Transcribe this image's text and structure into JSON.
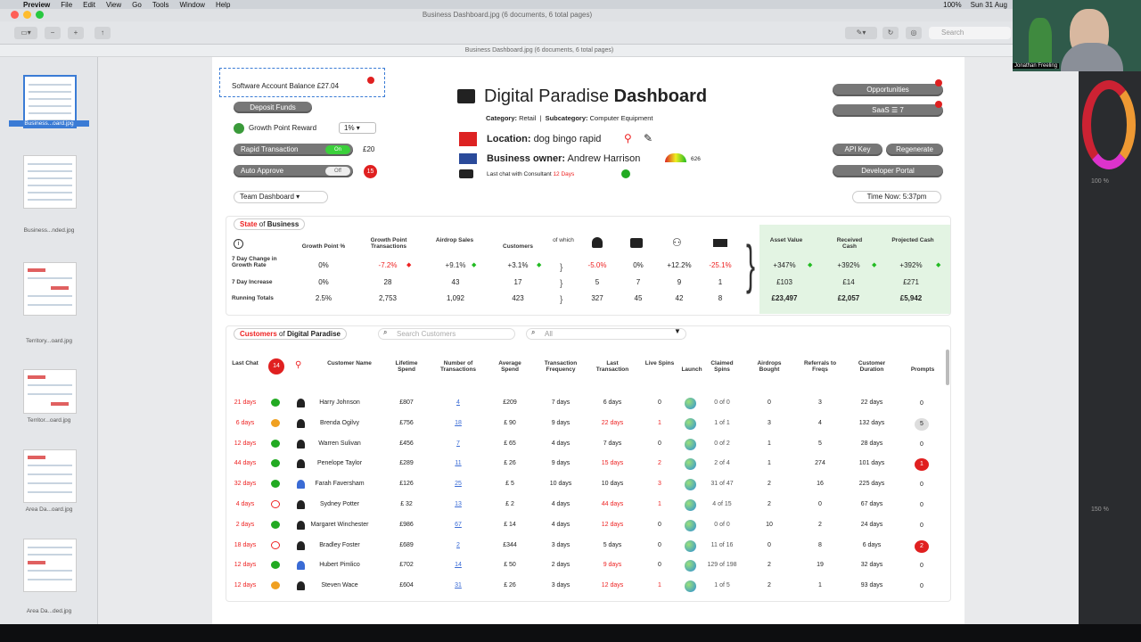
{
  "menubar": {
    "app": "Preview",
    "items": [
      "File",
      "Edit",
      "View",
      "Go",
      "Tools",
      "Window",
      "Help"
    ],
    "status": [
      "100%",
      "Sun 31 Aug"
    ]
  },
  "window": {
    "title": "Business Dashboard.jpg (6 documents, 6 total pages)",
    "subtitle": "Business Dashboard.jpg (6 documents, 6 total pages)",
    "search_placeholder": "Search"
  },
  "sidebar": {
    "thumbs": [
      {
        "label": "Business...oard.jpg"
      },
      {
        "label": "Business...nded.jpg"
      },
      {
        "label": "Territory...oard.jpg"
      },
      {
        "label": "Territor...oard.jpg"
      },
      {
        "label": "Area Da...oard.jpg"
      },
      {
        "label": "Area Da...ded.jpg"
      }
    ]
  },
  "video": {
    "name": "Jonathan Freeling"
  },
  "right_panel": {
    "zoom1": "100 %",
    "zoom2": "150 %"
  },
  "dash": {
    "account_balance": "Software Account Balance £27.04",
    "deposit": "Deposit Funds",
    "growth_reward": "Growth Point Reward",
    "growth_pct": "1%",
    "rapid": "Rapid Transaction",
    "rapid_state": "On",
    "rapid_amount": "£20",
    "auto": "Auto Approve",
    "auto_state": "Off",
    "auto_badge": "15",
    "title_light": "Digital Paradise",
    "title_bold": "Dashboard",
    "category_label": "Category:",
    "category": "Retail",
    "subcategory_label": "Subcategory:",
    "subcategory": "Computer Equipment",
    "location_label": "Location:",
    "location": "dog bingo rapid",
    "owner_label": "Business owner:",
    "owner": "Andrew Harrison",
    "owner_score": "626",
    "lastchat_label": "Last chat with Consultant",
    "lastchat_days": "12 Days",
    "opportunities": "Opportunities",
    "saas": "SaaS ☰ 7",
    "api_key": "API Key",
    "regenerate": "Regenerate",
    "dev_portal": "Developer Portal",
    "team_dashboard": "Team Dashboard",
    "time_now": "Time Now: 5:37pm"
  },
  "state": {
    "title_red": "State",
    "title_of": "of",
    "title_bold": "Business",
    "headers": [
      "Growth Point %",
      "Growth Point Transactions",
      "Airdrop Sales",
      "Customers",
      "of which",
      "Asset Value",
      "Received Cash",
      "Projected Cash"
    ],
    "row_labels": [
      "7 Day Change in Growth Rate",
      "7 Day Increase",
      "Running Totals"
    ],
    "rows": [
      [
        "0%",
        "-7.2%",
        "+9.1%",
        "+3.1%",
        "-5.0%",
        "0%",
        "+12.2%",
        "-25.1%",
        "+347%",
        "+392%",
        "+392%"
      ],
      [
        "0%",
        "28",
        "43",
        "17",
        "5",
        "7",
        "9",
        "1",
        "£103",
        "£14",
        "£271"
      ],
      [
        "2.5%",
        "2,753",
        "1,092",
        "423",
        "327",
        "45",
        "42",
        "8",
        "£23,497",
        "£2,057",
        "£5,942"
      ]
    ]
  },
  "customers": {
    "title_red": "Customers",
    "title_of": "of",
    "title_bold": "Digital Paradise",
    "search_placeholder": "Search Customers",
    "filter": "All",
    "badge": "14",
    "headers": [
      "Last Chat",
      "Customer Name",
      "Lifetime Spend",
      "Number of Transactions",
      "Average Spend",
      "Transaction Frequency",
      "Last Transaction",
      "Live Spins",
      "Launch",
      "Claimed Spins",
      "Airdrops Bought",
      "Referrals to Freqs",
      "Customer Duration",
      "Prompts"
    ],
    "rows": [
      {
        "chat": "21 days",
        "name": "Harry Johnson",
        "spend": "£807",
        "tx": "4",
        "avg": "£209",
        "freq": "7 days",
        "last": "6 days",
        "live": "0",
        "claimed": "0 of 0",
        "air": "0",
        "ref": "3",
        "dur": "22 days",
        "prompts": "0"
      },
      {
        "chat": "6 days",
        "name": "Brenda Ogilvy",
        "spend": "£756",
        "tx": "18",
        "avg": "£  90",
        "freq": "9 days",
        "last": "22 days",
        "live": "1",
        "claimed": "1 of 1",
        "air": "3",
        "ref": "4",
        "dur": "132 days",
        "prompts": "5"
      },
      {
        "chat": "12 days",
        "name": "Warren Sulivan",
        "spend": "£456",
        "tx": "7",
        "avg": "£  65",
        "freq": "4 days",
        "last": "7 days",
        "live": "0",
        "claimed": "0 of 2",
        "air": "1",
        "ref": "5",
        "dur": "28 days",
        "prompts": "0"
      },
      {
        "chat": "44 days",
        "name": "Penelope Taylor",
        "spend": "£289",
        "tx": "11",
        "avg": "£  26",
        "freq": "9 days",
        "last": "15 days",
        "live": "2",
        "claimed": "2 of 4",
        "air": "1",
        "ref": "274",
        "dur": "101 days",
        "prompts": "1"
      },
      {
        "chat": "32 days",
        "name": "Farah Faversham",
        "spend": "£126",
        "tx": "25",
        "avg": "£    5",
        "freq": "10 days",
        "last": "10 days",
        "live": "3",
        "claimed": "31 of 47",
        "air": "2",
        "ref": "16",
        "dur": "225 days",
        "prompts": "0"
      },
      {
        "chat": "4 days",
        "name": "Sydney Potter",
        "spend": "£  32",
        "tx": "13",
        "avg": "£    2",
        "freq": "4 days",
        "last": "44 days",
        "live": "1",
        "claimed": "4 of 15",
        "air": "2",
        "ref": "0",
        "dur": "67 days",
        "prompts": "0"
      },
      {
        "chat": "2 days",
        "name": "Margaret Winchester",
        "spend": "£986",
        "tx": "67",
        "avg": "£  14",
        "freq": "4 days",
        "last": "12 days",
        "live": "0",
        "claimed": "0 of 0",
        "air": "10",
        "ref": "2",
        "dur": "24 days",
        "prompts": "0"
      },
      {
        "chat": "18 days",
        "name": "Bradley Foster",
        "spend": "£689",
        "tx": "2",
        "avg": "£344",
        "freq": "3 days",
        "last": "5 days",
        "live": "0",
        "claimed": "11 of 16",
        "air": "0",
        "ref": "8",
        "dur": "6 days",
        "prompts": "2"
      },
      {
        "chat": "12 days",
        "name": "Hubert Pimlico",
        "spend": "£702",
        "tx": "14",
        "avg": "£  50",
        "freq": "2 days",
        "last": "9 days",
        "live": "0",
        "claimed": "129 of 198",
        "air": "2",
        "ref": "19",
        "dur": "32 days",
        "prompts": "0"
      },
      {
        "chat": "12 days",
        "name": "Steven Wace",
        "spend": "£604",
        "tx": "31",
        "avg": "£  26",
        "freq": "3 days",
        "last": "12 days",
        "live": "1",
        "claimed": "1 of 5",
        "air": "2",
        "ref": "1",
        "dur": "93 days",
        "prompts": "0"
      }
    ]
  }
}
